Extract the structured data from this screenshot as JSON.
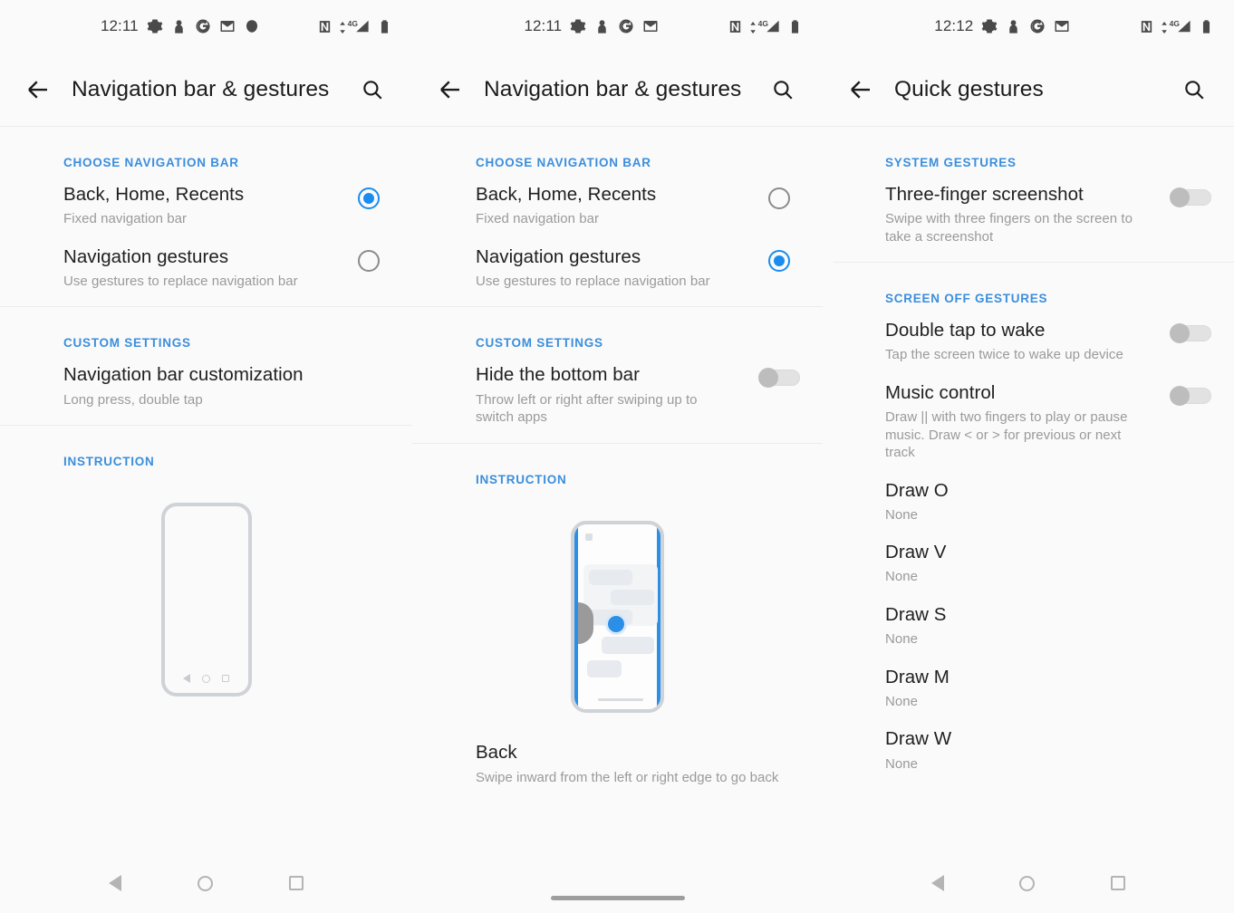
{
  "theme": {
    "accent_blue": "#3b8edc",
    "control_blue": "#1a8cf0",
    "text_primary": "#1f1f1f",
    "text_secondary": "#9a9a9a",
    "background": "#fafafa"
  },
  "panels": [
    {
      "status_bar": {
        "time": "12:11",
        "left_icons": [
          "gear-icon",
          "person-icon",
          "google-icon",
          "gmail-icon",
          "app-icon"
        ],
        "right_icons": [
          "nfc-icon",
          "signal-4g-icon",
          "battery-icon"
        ],
        "network_label": "4G"
      },
      "app_bar": {
        "back_label": "Back",
        "title": "Navigation bar & gestures",
        "search_label": "Search"
      },
      "sections": [
        {
          "header": "CHOOSE NAVIGATION BAR",
          "rows": [
            {
              "title": "Back, Home, Recents",
              "subtitle": "Fixed navigation bar",
              "control": "radio",
              "state": "on"
            },
            {
              "title": "Navigation gestures",
              "subtitle": "Use gestures to replace navigation bar",
              "control": "radio",
              "state": "off"
            }
          ]
        },
        {
          "header": "CUSTOM SETTINGS",
          "rows": [
            {
              "title": "Navigation bar customization",
              "subtitle": "Long press, double tap",
              "control": "none",
              "state": ""
            }
          ]
        },
        {
          "header": "INSTRUCTION",
          "rows": []
        }
      ],
      "illustration": {
        "type": "phone-outline-navbar",
        "nav_icons": [
          "back-triangle-icon",
          "home-circle-icon",
          "recents-square-icon"
        ]
      },
      "caption": null,
      "bottom_bar": {
        "type": "three-button",
        "buttons": [
          "back-triangle-icon",
          "home-circle-icon",
          "recents-square-icon"
        ]
      }
    },
    {
      "status_bar": {
        "time": "12:11",
        "left_icons": [
          "gear-icon",
          "person-icon",
          "google-icon",
          "gmail-icon"
        ],
        "right_icons": [
          "nfc-icon",
          "signal-4g-icon",
          "battery-icon"
        ],
        "network_label": "4G"
      },
      "app_bar": {
        "back_label": "Back",
        "title": "Navigation bar & gestures",
        "search_label": "Search"
      },
      "sections": [
        {
          "header": "CHOOSE NAVIGATION BAR",
          "rows": [
            {
              "title": "Back, Home, Recents",
              "subtitle": "Fixed navigation bar",
              "control": "radio",
              "state": "off"
            },
            {
              "title": "Navigation gestures",
              "subtitle": "Use gestures to replace navigation bar",
              "control": "radio",
              "state": "on"
            }
          ]
        },
        {
          "header": "CUSTOM SETTINGS",
          "rows": [
            {
              "title": "Hide the bottom bar",
              "subtitle": "Throw left or right after swiping up to switch apps",
              "control": "switch",
              "state": "off"
            }
          ]
        },
        {
          "header": "INSTRUCTION",
          "rows": []
        }
      ],
      "illustration": {
        "type": "phone-gesture-demo"
      },
      "caption": {
        "title": "Back",
        "subtitle": "Swipe inward from the left or right edge to go back"
      },
      "bottom_bar": {
        "type": "gesture-pill",
        "buttons": []
      }
    },
    {
      "status_bar": {
        "time": "12:12",
        "left_icons": [
          "gear-icon",
          "person-icon",
          "google-icon",
          "gmail-icon"
        ],
        "right_icons": [
          "nfc-icon",
          "signal-4g-icon",
          "battery-icon"
        ],
        "network_label": "4G"
      },
      "app_bar": {
        "back_label": "Back",
        "title": "Quick gestures",
        "search_label": "Search"
      },
      "sections": [
        {
          "header": "SYSTEM GESTURES",
          "rows": [
            {
              "title": "Three-finger screenshot",
              "subtitle": "Swipe with three fingers on the screen to take a screenshot",
              "control": "switch",
              "state": "off"
            }
          ]
        },
        {
          "header": "SCREEN OFF GESTURES",
          "rows": [
            {
              "title": "Double tap to wake",
              "subtitle": "Tap the screen twice to wake up device",
              "control": "switch",
              "state": "off"
            },
            {
              "title": "Music control",
              "subtitle": "Draw || with two fingers to play or pause music. Draw < or > for previous or next track",
              "control": "switch",
              "state": "off"
            },
            {
              "title": "Draw O",
              "subtitle": "None",
              "control": "none",
              "state": ""
            },
            {
              "title": "Draw V",
              "subtitle": "None",
              "control": "none",
              "state": ""
            },
            {
              "title": "Draw S",
              "subtitle": "None",
              "control": "none",
              "state": ""
            },
            {
              "title": "Draw M",
              "subtitle": "None",
              "control": "none",
              "state": ""
            },
            {
              "title": "Draw W",
              "subtitle": "None",
              "control": "none",
              "state": ""
            }
          ]
        }
      ],
      "illustration": null,
      "caption": null,
      "bottom_bar": {
        "type": "three-button",
        "buttons": [
          "back-triangle-icon",
          "home-circle-icon",
          "recents-square-icon"
        ]
      }
    }
  ]
}
